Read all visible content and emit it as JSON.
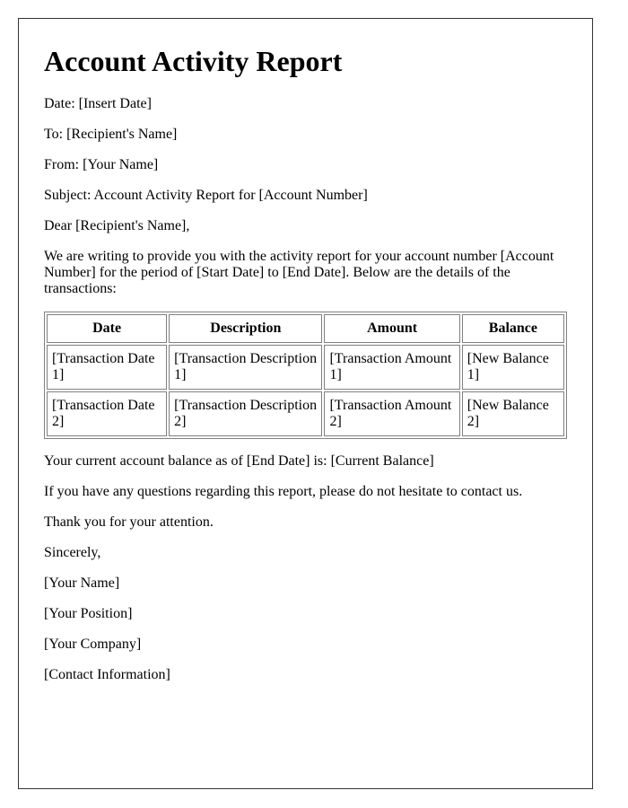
{
  "title": "Account Activity Report",
  "header_lines": {
    "date": "Date: [Insert Date]",
    "to": "To: [Recipient's Name]",
    "from": "From: [Your Name]",
    "subject": "Subject: Account Activity Report for [Account Number]"
  },
  "salutation": "Dear [Recipient's Name],",
  "intro": "We are writing to provide you with the activity report for your account number [Account Number] for the period of [Start Date] to [End Date]. Below are the details of the transactions:",
  "table": {
    "headers": [
      "Date",
      "Description",
      "Amount",
      "Balance"
    ],
    "rows": [
      [
        "[Transaction Date 1]",
        "[Transaction Description 1]",
        "[Transaction Amount 1]",
        "[New Balance 1]"
      ],
      [
        "[Transaction Date 2]",
        "[Transaction Description 2]",
        "[Transaction Amount 2]",
        "[New Balance 2]"
      ]
    ]
  },
  "balance_line": "Your current account balance as of [End Date] is: [Current Balance]",
  "questions_line": "If you have any questions regarding this report, please do not hesitate to contact us.",
  "thanks_line": "Thank you for your attention.",
  "closing": "Sincerely,",
  "signature": {
    "name": "[Your Name]",
    "position": "[Your Position]",
    "company": "[Your Company]",
    "contact": "[Contact Information]"
  }
}
